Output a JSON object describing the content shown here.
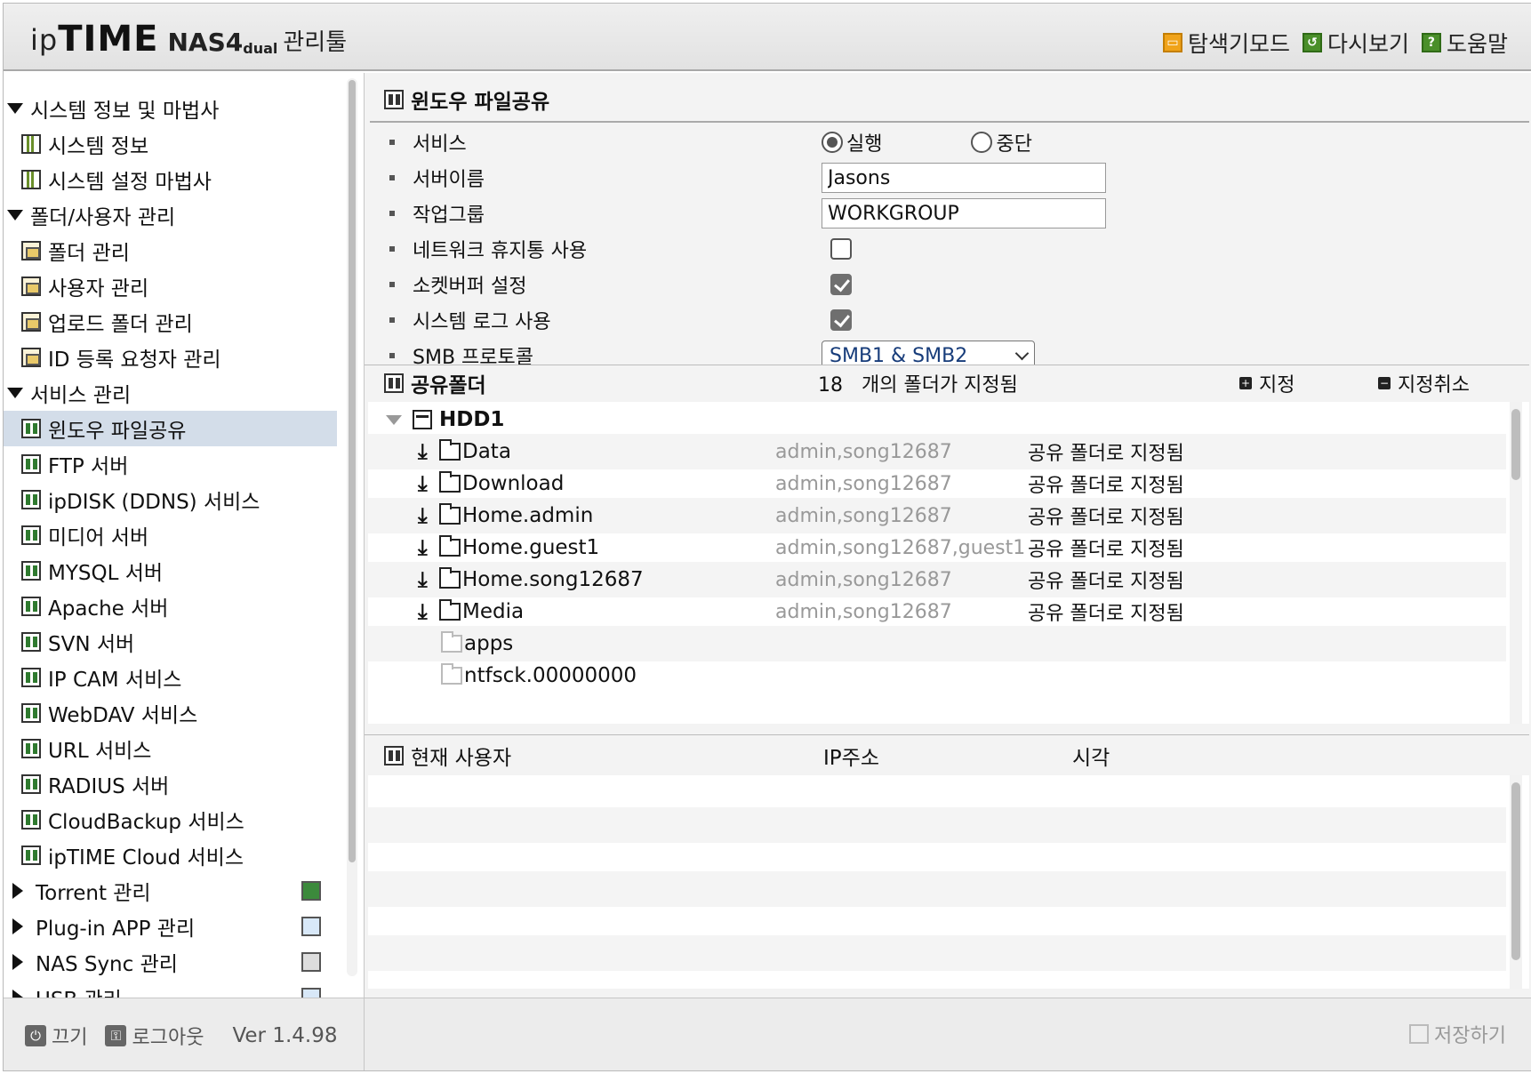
{
  "header": {
    "logo_ip": "ip",
    "logo_time": "TIME",
    "logo_model": "NAS4",
    "logo_sub": "dual",
    "logo_tool": "관리툴",
    "nav": [
      {
        "label": "탐색기모드",
        "icon": "explorer-icon"
      },
      {
        "label": "다시보기",
        "icon": "refresh-icon"
      },
      {
        "label": "도움말",
        "icon": "help-icon"
      }
    ]
  },
  "sidebar": {
    "groups": [
      {
        "label": "시스템 정보 및 마법사",
        "expanded": true,
        "items": [
          {
            "label": "시스템 정보",
            "icon": "chart-icon"
          },
          {
            "label": "시스템 설정 마법사",
            "icon": "chart-icon"
          }
        ]
      },
      {
        "label": "폴더/사용자 관리",
        "expanded": true,
        "items": [
          {
            "label": "폴더 관리",
            "icon": "folder-icon"
          },
          {
            "label": "사용자 관리",
            "icon": "folder-icon"
          },
          {
            "label": "업로드 폴더 관리",
            "icon": "folder-icon"
          },
          {
            "label": "ID 등록 요청자 관리",
            "icon": "folder-icon"
          }
        ]
      },
      {
        "label": "서비스 관리",
        "expanded": true,
        "items": [
          {
            "label": "윈도우 파일공유",
            "icon": "service-icon",
            "active": true
          },
          {
            "label": "FTP 서버",
            "icon": "service-icon"
          },
          {
            "label": "ipDISK (DDNS) 서비스",
            "icon": "service-icon"
          },
          {
            "label": "미디어 서버",
            "icon": "service-icon"
          },
          {
            "label": "MYSQL 서버",
            "icon": "service-icon"
          },
          {
            "label": "Apache 서버",
            "icon": "service-icon"
          },
          {
            "label": "SVN 서버",
            "icon": "service-icon"
          },
          {
            "label": "IP CAM 서비스",
            "icon": "service-icon"
          },
          {
            "label": "WebDAV 서비스",
            "icon": "service-icon"
          },
          {
            "label": "URL 서비스",
            "icon": "service-icon"
          },
          {
            "label": "RADIUS 서버",
            "icon": "service-icon"
          },
          {
            "label": "CloudBackup 서비스",
            "icon": "service-icon"
          },
          {
            "label": "ipTIME Cloud 서비스",
            "icon": "service-icon"
          }
        ]
      },
      {
        "label": "Torrent 관리",
        "expanded": false,
        "right_icon": "torrent-icon"
      },
      {
        "label": "Plug-in APP 관리",
        "expanded": false,
        "right_icon": "plugin-icon"
      },
      {
        "label": "NAS Sync 관리",
        "expanded": false,
        "right_icon": "sync-icon"
      },
      {
        "label": "USB 관리",
        "expanded": false,
        "right_icon": "usb-icon"
      }
    ],
    "footer": {
      "power_label": "끄기",
      "logout_label": "로그아웃",
      "version": "Ver 1.4.98"
    }
  },
  "main": {
    "title": "윈도우 파일공유",
    "settings": {
      "service_label": "서비스",
      "service_on": "실행",
      "service_off": "중단",
      "service_value": "실행",
      "server_name_label": "서버이름",
      "server_name_value": "Jasons",
      "workgroup_label": "작업그룹",
      "workgroup_value": "WORKGROUP",
      "recycle_label": "네트워크 휴지통 사용",
      "recycle_checked": false,
      "socket_label": "소켓버퍼 설정",
      "socket_checked": true,
      "syslog_label": "시스템 로그 사용",
      "syslog_checked": true,
      "smb_label": "SMB 프로토콜",
      "smb_value": "SMB1 & SMB2"
    },
    "share": {
      "title": "공유폴더",
      "count": "18",
      "count_suffix": "개의 폴더가 지정됨",
      "assign_label": "지정",
      "unassign_label": "지정취소",
      "hdd": "HDD1",
      "folders": [
        {
          "name": "Data",
          "users": "admin,song12687",
          "status": "공유 폴더로 지정됨",
          "shared": true
        },
        {
          "name": "Download",
          "users": "admin,song12687",
          "status": "공유 폴더로 지정됨",
          "shared": true
        },
        {
          "name": "Home.admin",
          "users": "admin,song12687",
          "status": "공유 폴더로 지정됨",
          "shared": true
        },
        {
          "name": "Home.guest1",
          "users": "admin,song12687,guest1",
          "status": "공유 폴더로 지정됨",
          "shared": true
        },
        {
          "name": "Home.song12687",
          "users": "admin,song12687",
          "status": "공유 폴더로 지정됨",
          "shared": true
        },
        {
          "name": "Media",
          "users": "admin,song12687",
          "status": "공유 폴더로 지정됨",
          "shared": true
        },
        {
          "name": "apps",
          "users": "",
          "status": "",
          "shared": false
        },
        {
          "name": "ntfsck.00000000",
          "users": "",
          "status": "",
          "shared": false
        }
      ]
    },
    "users": {
      "title": "현재 사용자",
      "col_ip": "IP주소",
      "col_time": "시각",
      "rows": []
    },
    "save_label": "저장하기"
  }
}
